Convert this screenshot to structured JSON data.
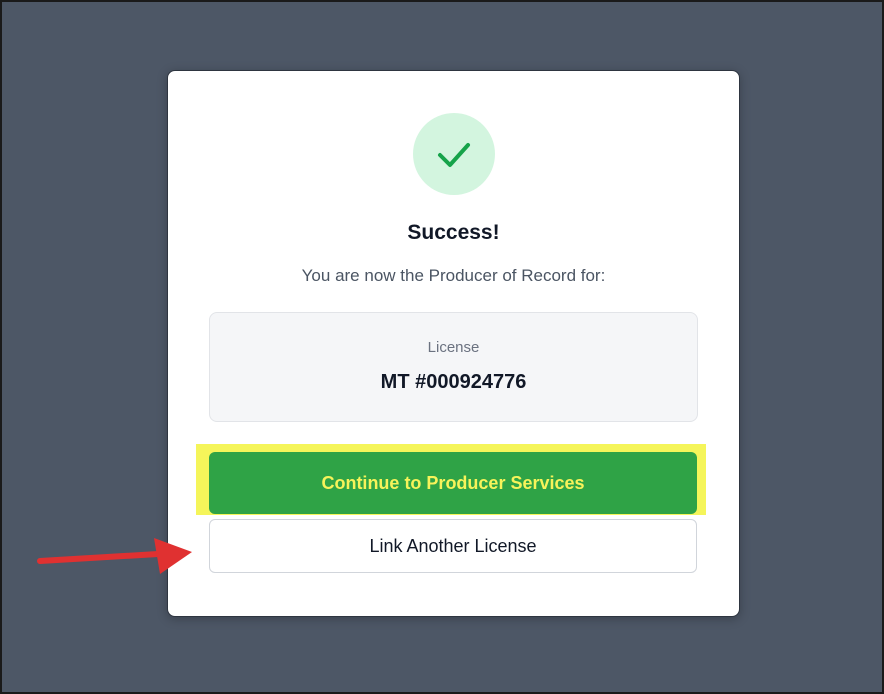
{
  "modal": {
    "title": "Success!",
    "subtitle": "You are now the Producer of Record for:",
    "license": {
      "label": "License",
      "value": "MT #000924776"
    },
    "primary_button": "Continue to Producer Services",
    "secondary_button": "Link Another License"
  },
  "icons": {
    "success": "check-icon",
    "annotation": "arrow-right-icon"
  },
  "colors": {
    "backdrop": "#4d5766",
    "success_circle": "#d3f5df",
    "check": "#16a34a",
    "primary_button": "#2fa346",
    "primary_text": "#f7f35a",
    "highlight": "#f5f55a",
    "arrow": "#e03131"
  }
}
